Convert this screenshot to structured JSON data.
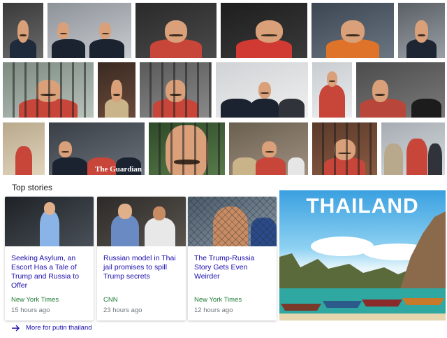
{
  "image_results": {
    "rows": [
      [
        {
          "caption": ""
        },
        {
          "caption": ""
        },
        {
          "caption": ""
        },
        {
          "caption": ""
        },
        {
          "caption": ""
        },
        {
          "caption": ""
        }
      ],
      [
        {
          "caption": ""
        },
        {
          "caption": ""
        },
        {
          "caption": ""
        },
        {
          "caption": ""
        },
        {
          "caption": ""
        },
        {
          "caption": ""
        }
      ],
      [
        {
          "caption": ""
        },
        {
          "caption": ""
        },
        {
          "caption": "The Guardian"
        },
        {
          "caption": ""
        },
        {
          "caption": ""
        },
        {
          "caption": ""
        },
        {
          "caption": ""
        }
      ]
    ],
    "guardian_logo_text": "The Guardian"
  },
  "top_stories": {
    "section_title": "Top stories",
    "cards": [
      {
        "headline": "Seeking Asylum, an Escort Has a Tale of Trump and Russia to Offer",
        "source": "New York Times",
        "time": "15 hours ago"
      },
      {
        "headline": "Russian model in Thai jail promises to spill Trump secrets",
        "source": "CNN",
        "time": "23 hours ago"
      },
      {
        "headline": "The Trump-Russia Story Gets Even Weirder",
        "source": "New York Times",
        "time": "12 hours ago"
      }
    ],
    "more_link": "More for putin thailand"
  },
  "promo": {
    "title": "THAILAND"
  },
  "colors": {
    "headline_link": "#1a0dab",
    "source_green": "#1e7b34",
    "time_gray": "#70757a",
    "red_shirt": "#c8453a"
  },
  "icons": {
    "more_arrow": "arrow-right-icon"
  }
}
